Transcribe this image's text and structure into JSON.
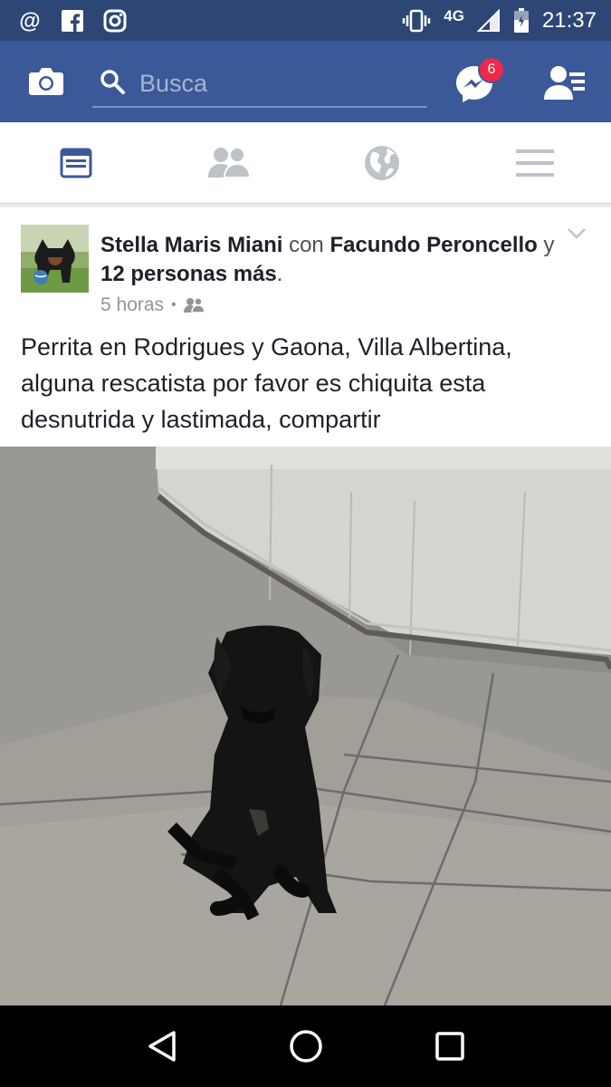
{
  "status_bar": {
    "left_icons": [
      "at-icon",
      "facebook-icon",
      "instagram-icon"
    ],
    "right_icons": [
      "vibrate-icon",
      "signal-icon",
      "battery-icon"
    ],
    "network": "4G",
    "time": "21:37"
  },
  "app_bar": {
    "search_placeholder": "Busca",
    "messenger_badge": "6",
    "color": "#3b5998"
  },
  "tabs": [
    {
      "icon": "news-feed-icon",
      "active": true
    },
    {
      "icon": "friends-icon",
      "active": false
    },
    {
      "icon": "globe-icon",
      "active": false
    },
    {
      "icon": "menu-icon",
      "active": false
    }
  ],
  "post": {
    "author": "Stella Maris Miani",
    "with_word": "con",
    "tagged": "Facundo Peroncello",
    "and_word": "y",
    "others": "12 personas más",
    "period": ".",
    "time": "5 horas",
    "audience_icon": "friends-icon",
    "text": "Perrita en Rodrigues y Gaona, Villa Albertina, alguna rescatista por favor es chiquita esta desnutrida y lastimada, compartir"
  },
  "nav": [
    "back-icon",
    "home-icon",
    "recents-icon"
  ]
}
